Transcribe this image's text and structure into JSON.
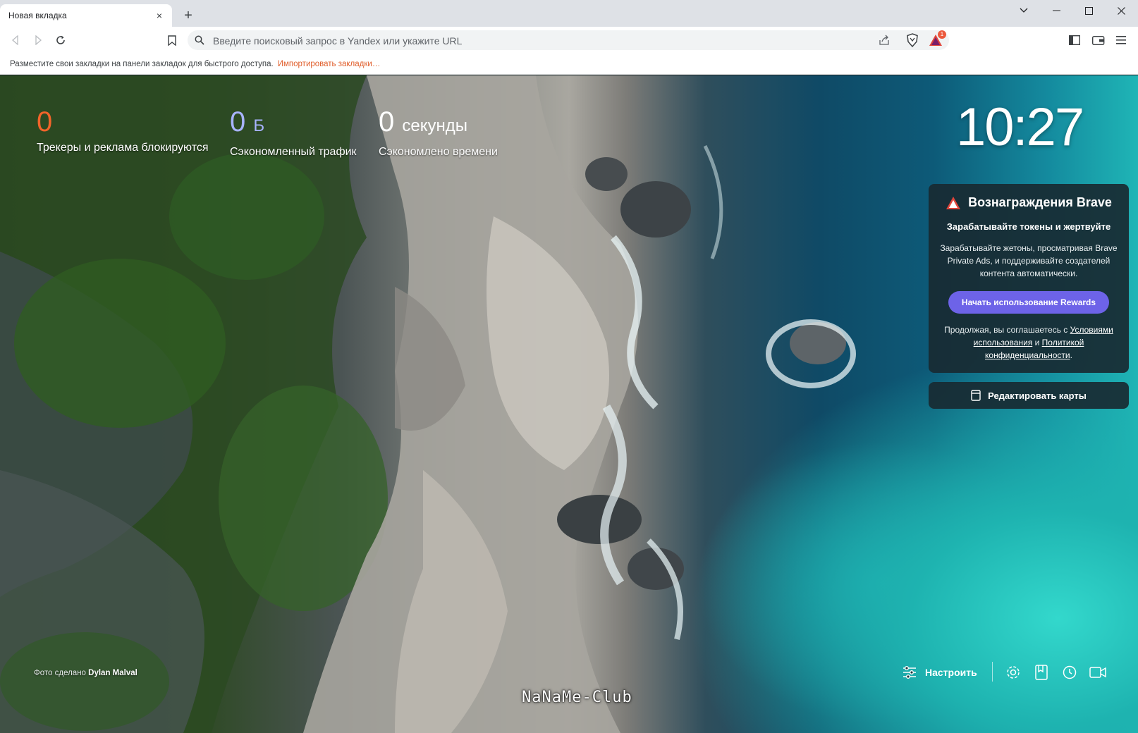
{
  "tab": {
    "title": "Новая вкладка",
    "close_icon": "×",
    "new_tab_icon": "+"
  },
  "omnibox": {
    "placeholder": "Введите поисковый запрос в Yandex или укажите URL",
    "value": ""
  },
  "brave_badge": {
    "count": "1"
  },
  "bookmarks_bar": {
    "message": "Разместите свои закладки на панели закладок для быстрого доступа.",
    "import_link": "Импортировать закладки…"
  },
  "stats": [
    {
      "value": "0",
      "unit": "",
      "label": "Трекеры и реклама блокируются",
      "color": "#f2642a"
    },
    {
      "value": "0",
      "unit": "Б",
      "label": "Сэкономленный трафик",
      "color": "#a8b3ff"
    },
    {
      "value": "0",
      "unit": "секунды",
      "label": "Сэкономлено времени",
      "color": "#ffffff"
    }
  ],
  "clock": "10:27",
  "rewards": {
    "title": "Вознаграждения Brave",
    "subtitle": "Зарабатывайте токены и жертвуйте",
    "description": "Зарабатывайте жетоны, просматривая Brave Private Ads, и поддерживайте создателей контента автоматически.",
    "button": "Начать использование Rewards",
    "legal_prefix": "Продолжая, вы соглашаетесь с",
    "terms_link": "Условиями использования",
    "legal_and": "и",
    "privacy_link": "Политикой конфиденциальности",
    "legal_suffix": "."
  },
  "edit_cards": "Редактировать карты",
  "photo_credit": {
    "prefix": "Фото сделано",
    "author": "Dylan Malval"
  },
  "customize": "Настроить",
  "watermark": "NaNaMe-Club"
}
